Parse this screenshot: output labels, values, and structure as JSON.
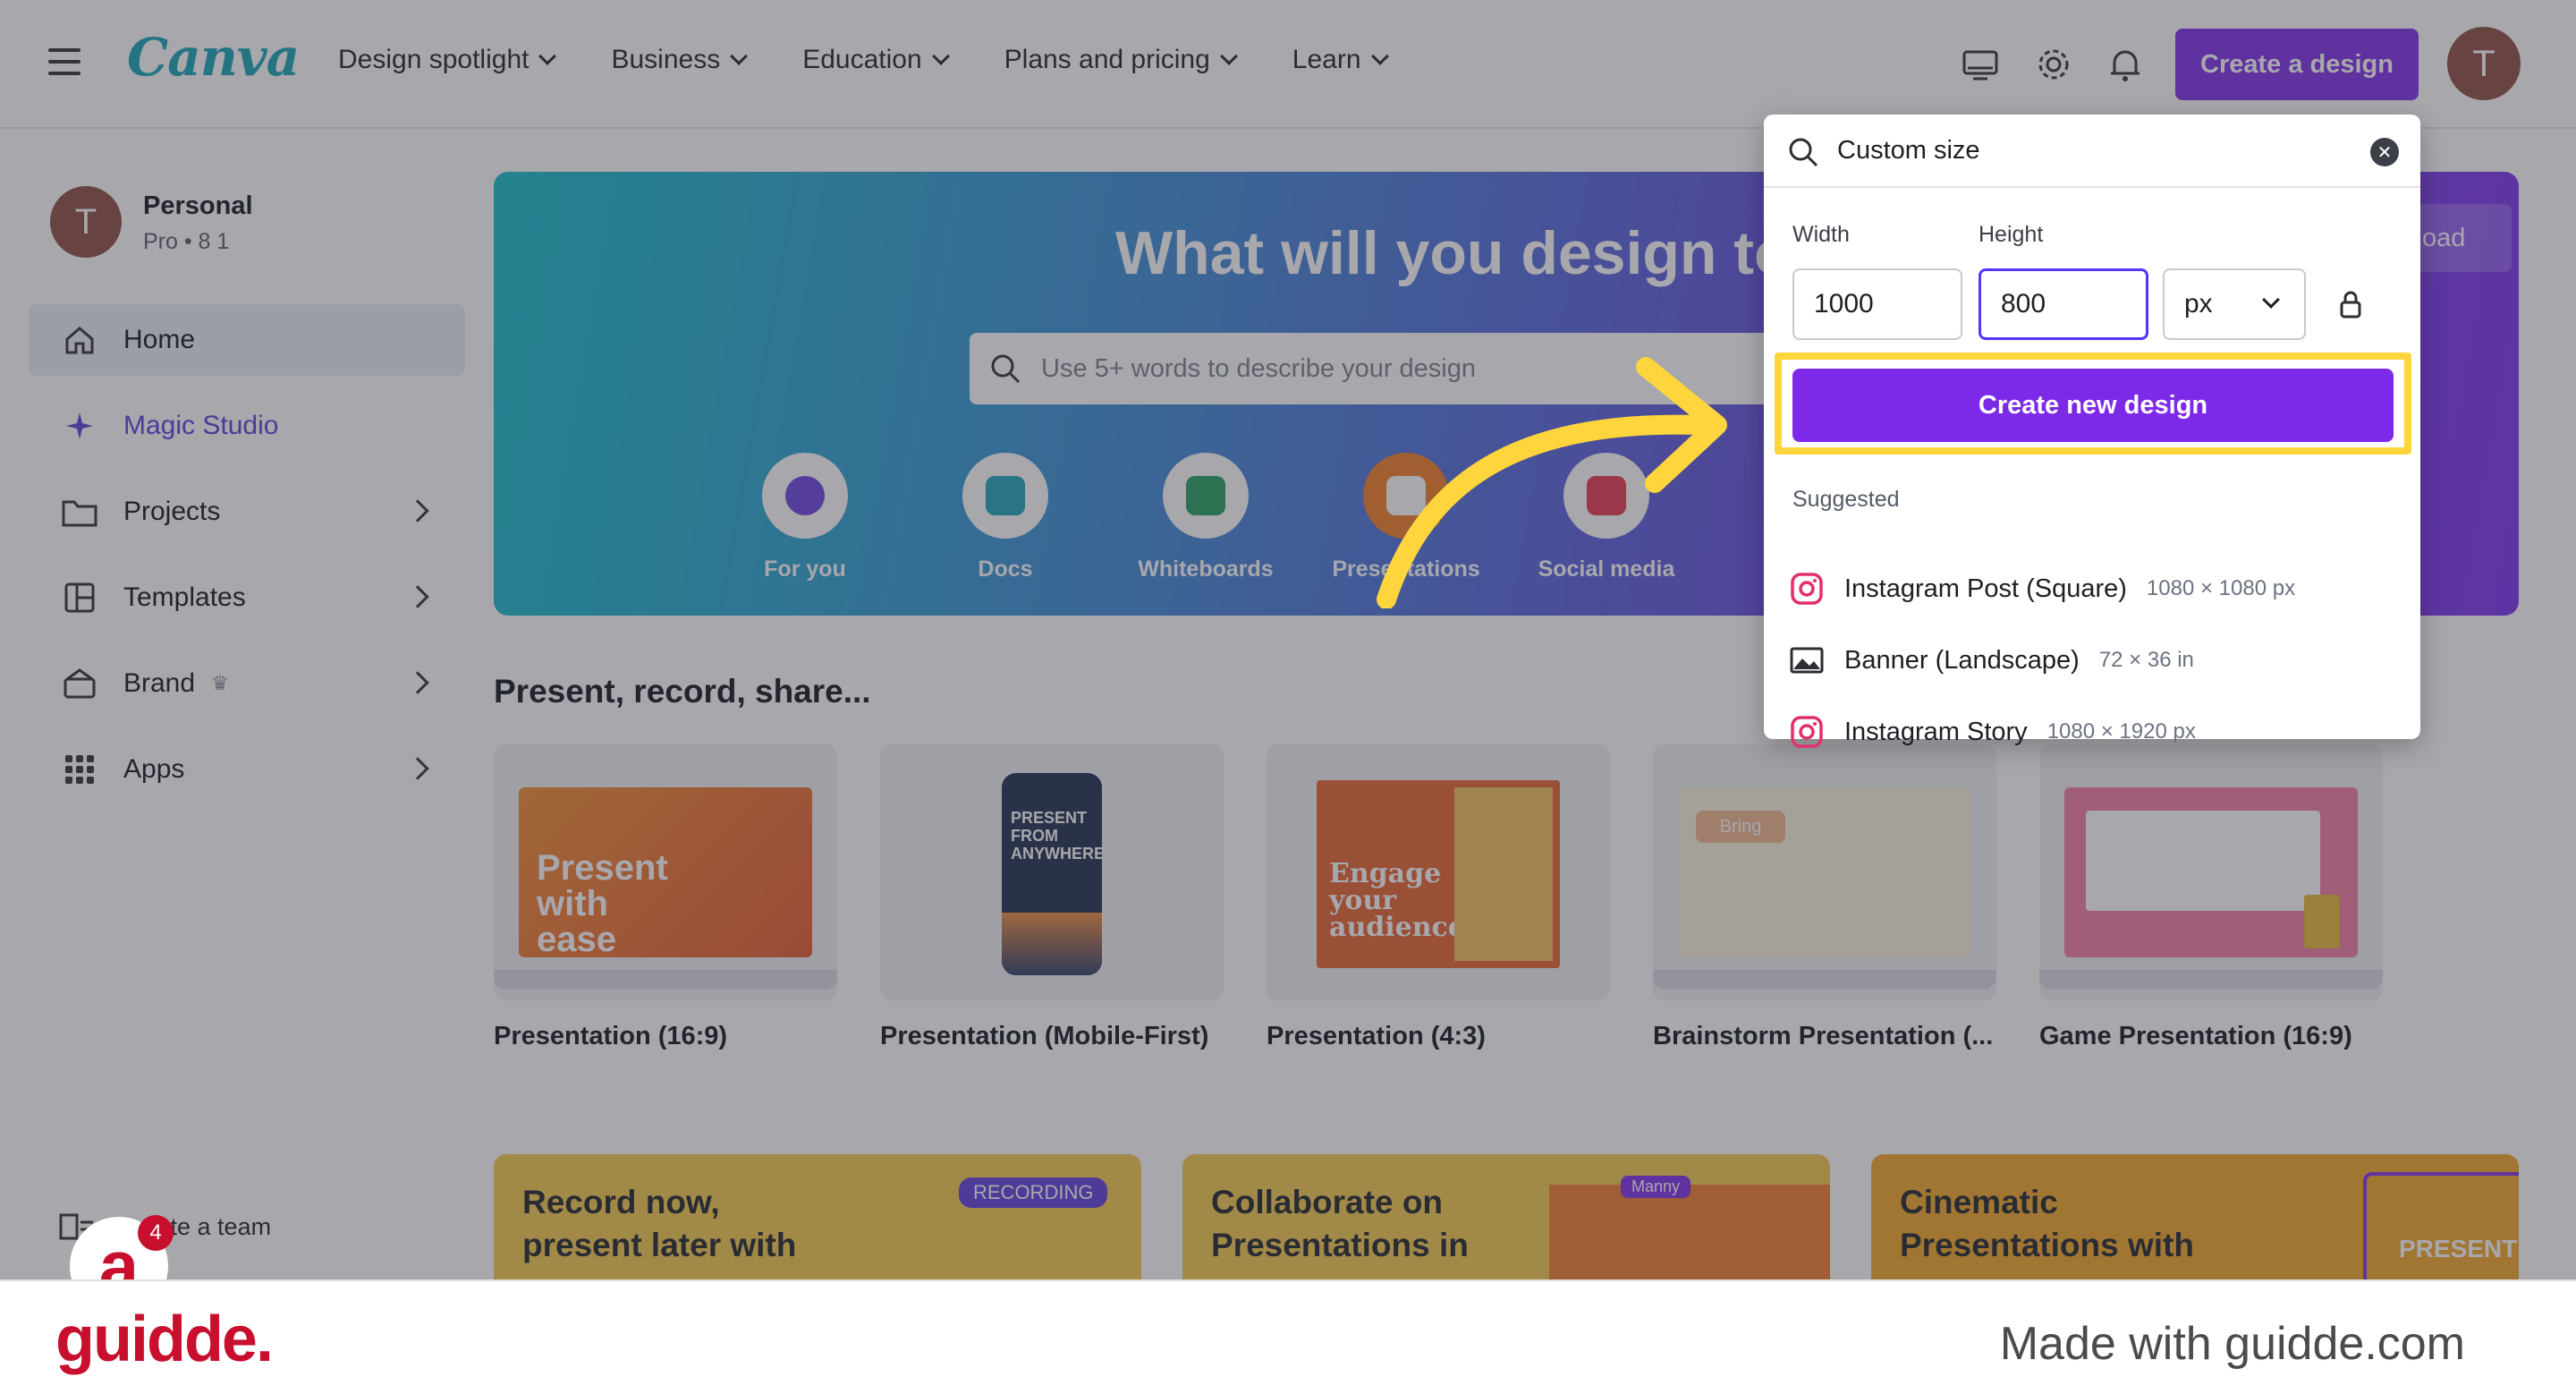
{
  "nav": {
    "logo": "Canva",
    "items": [
      {
        "label": "Design spotlight"
      },
      {
        "label": "Business"
      },
      {
        "label": "Education"
      },
      {
        "label": "Plans and pricing"
      },
      {
        "label": "Learn"
      }
    ],
    "create_label": "Create a design",
    "avatar_initial": "T",
    "icons": [
      "desktop-icon",
      "gear-icon",
      "bell-icon"
    ]
  },
  "sidebar": {
    "account_name": "Personal",
    "account_sub": "Pro • 8 1",
    "avatar_initial": "T",
    "items": [
      {
        "label": "Home"
      },
      {
        "label": "Magic Studio"
      },
      {
        "label": "Projects"
      },
      {
        "label": "Templates"
      },
      {
        "label": "Brand"
      },
      {
        "label": "Apps"
      }
    ],
    "create_team": "Create a team",
    "notif_count": "4"
  },
  "hero": {
    "title": "What will you design to",
    "search_placeholder": "Use 5+ words to describe your design",
    "upload_label": "oad",
    "categories": [
      {
        "label": "For you",
        "color": "#6a3fe0"
      },
      {
        "label": "Docs",
        "color": "#1aa4b8"
      },
      {
        "label": "Whiteboards",
        "color": "#1f9e5c"
      },
      {
        "label": "Presentations",
        "color": "#f47d20"
      },
      {
        "label": "Social media",
        "color": "#e9334d"
      }
    ]
  },
  "section": {
    "title": "Present, record, share...",
    "cards": [
      {
        "caption": "Presentation (16:9)",
        "thumb_text": "Present with ease"
      },
      {
        "caption": "Presentation (Mobile-First)",
        "thumb_text": "PRESENT FROM ANYWHERE"
      },
      {
        "caption": "Presentation (4:3)",
        "thumb_text": "Engage your audience"
      },
      {
        "caption": "Brainstorm Presentation (...",
        "thumb_text": "Bring"
      },
      {
        "caption": "Game Presentation (16:9)",
        "thumb_text": ""
      }
    ],
    "promos": [
      {
        "text": "Record now, present later with",
        "badge": "RECORDING"
      },
      {
        "text": "Collaborate on Presentations in",
        "badge": "Manny"
      },
      {
        "text": "Cinematic Presentations with",
        "badge": "PRESENT"
      }
    ]
  },
  "popup": {
    "search_value": "Custom size",
    "width_label": "Width",
    "height_label": "Height",
    "width_value": "1000",
    "height_value": "800",
    "unit": "px",
    "create_label": "Create new design",
    "suggested_label": "Suggested",
    "suggestions": [
      {
        "name": "Instagram Post (Square)",
        "size": "1080 × 1080 px"
      },
      {
        "name": "Banner (Landscape)",
        "size": "72 × 36 in"
      },
      {
        "name": "Instagram Story",
        "size": "1080 × 1920 px"
      }
    ]
  },
  "footer": {
    "logo": "guidde.",
    "made_with": "Made with guidde.com"
  },
  "colors": {
    "accent": "#7d2ae8",
    "highlight": "#ffd53d",
    "guidde_red": "#c8102e"
  }
}
